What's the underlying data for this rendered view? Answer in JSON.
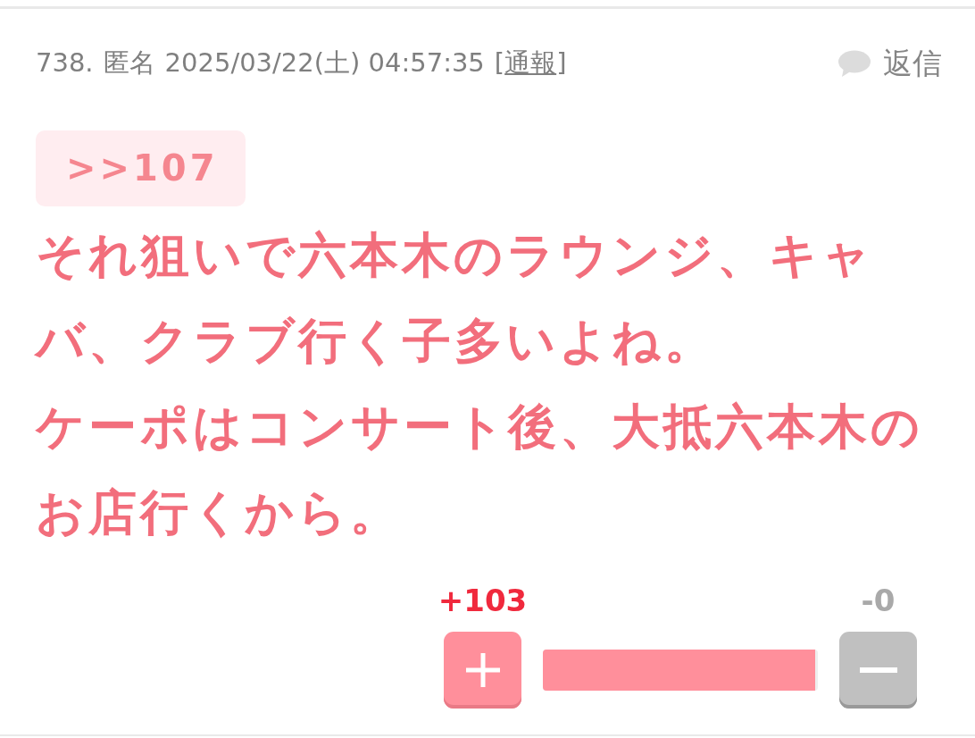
{
  "post": {
    "number": "738.",
    "author": "匿名",
    "datetime": "2025/03/22(土) 04:57:35",
    "report_link": {
      "before": "[",
      "label": "通報",
      "after": "]"
    },
    "reply_button": "返信",
    "anchor": ">>107",
    "body": [
      "それ狙いで六本木のラウンジ、キャバ、クラブ行く子多いよね。",
      "ケーポはコンサート後、大抵六本木のお店行くから。"
    ],
    "votes": {
      "plus_count": "+103",
      "minus_count": "-0",
      "level": 0.99
    }
  }
}
